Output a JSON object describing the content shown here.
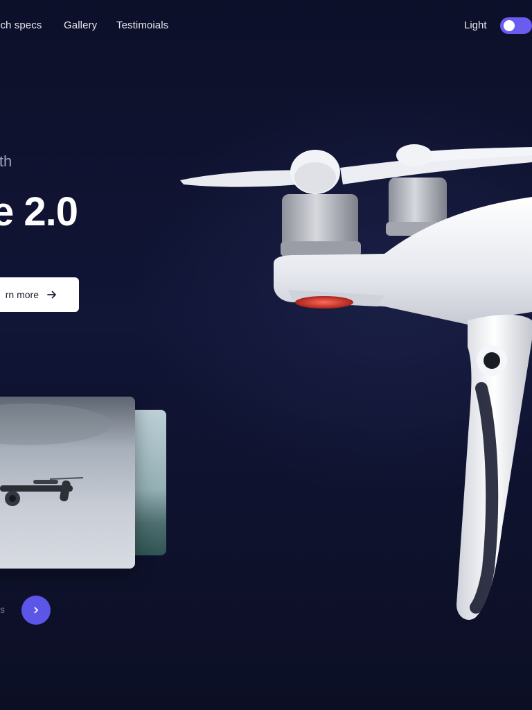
{
  "nav": {
    "items": [
      {
        "label": "ech specs"
      },
      {
        "label": "Gallery"
      },
      {
        "label": "Testimoials"
      }
    ],
    "theme_label": "Light",
    "theme_toggle_on": true
  },
  "hero": {
    "kicker": "ith",
    "headline": "e 2.0",
    "cta_label": "rn more"
  },
  "gallery": {
    "pager_label": "s"
  },
  "colors": {
    "background": "#0d1026",
    "accent": "#5b55e8",
    "toggle": "#6b5cf0",
    "text": "#ffffff",
    "muted": "#9ca2bd"
  },
  "icons": [
    "arrow-right-icon",
    "chevron-right-icon",
    "drone-image",
    "drone-thumbnail-image"
  ]
}
